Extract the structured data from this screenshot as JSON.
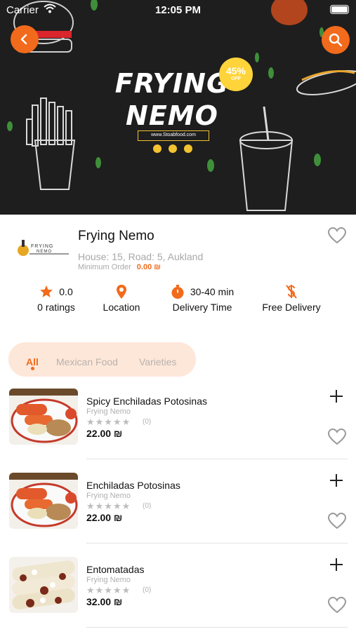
{
  "status_bar": {
    "carrier": "Carrier",
    "time": "12:05 PM"
  },
  "banner": {
    "title_line1": "FRYING",
    "title_line2": "NEMO",
    "badge_percent": "45%",
    "badge_off": "OFF",
    "url": "www.Stoabfood.com"
  },
  "restaurant": {
    "logo_text_top": "FRYING",
    "logo_text_bottom": "NEMO",
    "name": "Frying Nemo",
    "address": "House: 15, Road: 5, Aukland",
    "min_order_label": "Minimum Order",
    "min_order_value": "0.00 ₪"
  },
  "stats": {
    "rating_value": "0.0",
    "rating_label": "0 ratings",
    "location_label": "Location",
    "delivery_time_value": "30-40 min",
    "delivery_time_label": "Delivery Time",
    "delivery_fee_label": "Free Delivery"
  },
  "tabs": [
    {
      "label": "All",
      "active": true
    },
    {
      "label": "Mexican Food",
      "active": false
    },
    {
      "label": "Varieties",
      "active": false
    }
  ],
  "items": [
    {
      "name": "Spicy Enchiladas Potosinas",
      "restaurant": "Frying Nemo",
      "stars": "★★★★★",
      "rating_count": "(0)",
      "price": "22.00 ₪"
    },
    {
      "name": "Enchiladas Potosinas",
      "restaurant": "Frying Nemo",
      "stars": "★★★★★",
      "rating_count": "(0)",
      "price": "22.00 ₪"
    },
    {
      "name": "Entomatadas",
      "restaurant": "Frying Nemo",
      "stars": "★★★★★",
      "rating_count": "(0)",
      "price": "32.00 ₪"
    }
  ],
  "colors": {
    "accent": "#f26a1b",
    "badge": "#ffd43a",
    "tab_bg": "#fde7d9"
  },
  "icons": {
    "back": "chevron-left-icon",
    "search": "search-icon",
    "favorite": "heart-outline-icon",
    "rating": "star-icon",
    "location": "location-pin-icon",
    "time": "stopwatch-icon",
    "delivery": "no-dollar-icon",
    "add": "plus-icon"
  }
}
